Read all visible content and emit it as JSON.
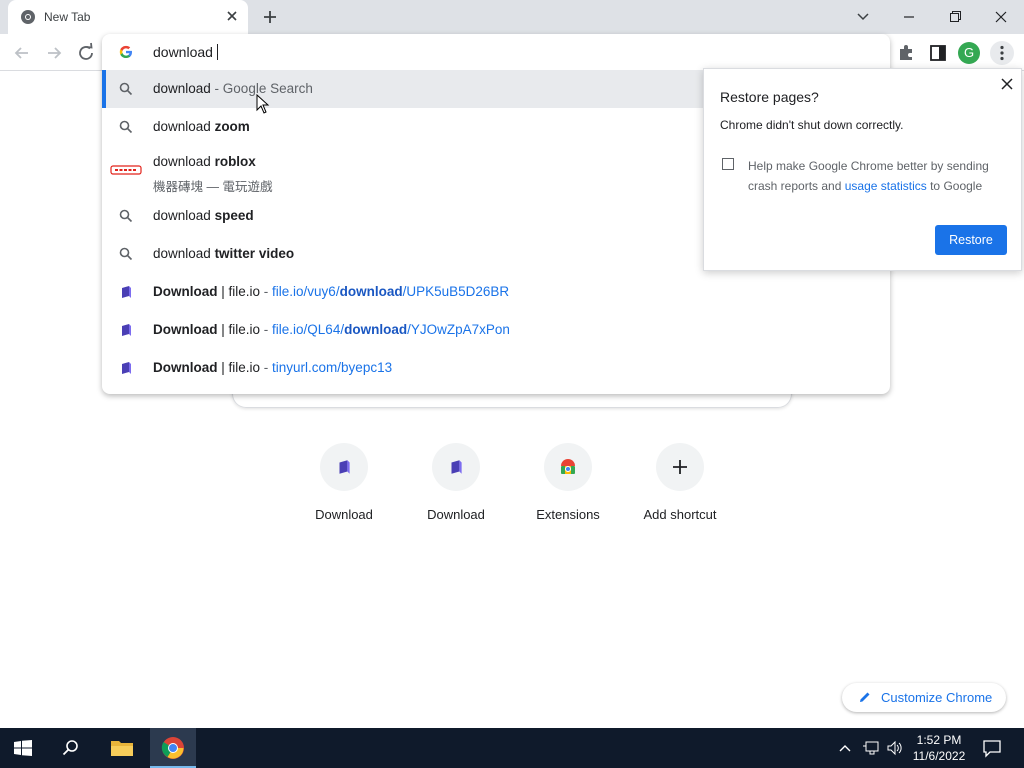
{
  "browser": {
    "tab": {
      "title": "New Tab"
    },
    "omnibox": {
      "query": "download"
    }
  },
  "suggestions": [
    {
      "icon": "search-icon",
      "prefix": "download",
      "bold": "",
      "sep": " - ",
      "rest": "Google Search"
    },
    {
      "icon": "search-icon",
      "prefix": "download ",
      "bold": "zoom"
    },
    {
      "icon": "roblox-icon",
      "prefix": "download ",
      "bold": "roblox",
      "sub": "機器磚塊 — 電玩遊戲"
    },
    {
      "icon": "search-icon",
      "prefix": "download ",
      "bold": "speed"
    },
    {
      "icon": "search-icon",
      "prefix": "download ",
      "bold": "twitter video"
    },
    {
      "icon": "fileio-icon",
      "title_bold": "Download",
      "title_rest": " | file.io",
      "sep": " - ",
      "url_a": "file.io/vuy6/",
      "url_b": "download",
      "url_c": "/UPK5uB5D26BR"
    },
    {
      "icon": "fileio-icon",
      "title_bold": "Download",
      "title_rest": " | file.io",
      "sep": " - ",
      "url_a": "file.io/QL64/",
      "url_b": "download",
      "url_c": "/YJOwZpA7xPon"
    },
    {
      "icon": "fileio-icon",
      "title_bold": "Download",
      "title_rest": " | file.io",
      "sep": " - ",
      "url_a": "tinyurl.com/byepc13",
      "url_b": "",
      "url_c": ""
    }
  ],
  "restore_popup": {
    "title": "Restore pages?",
    "message": "Chrome didn't shut down correctly.",
    "help_text_a": "Help make Google Chrome better by sending crash reports and ",
    "help_link": "usage statistics",
    "help_text_b": " to Google",
    "restore_label": "Restore"
  },
  "shortcuts": [
    {
      "label": "Download",
      "icon": "fileio-icon"
    },
    {
      "label": "Download",
      "icon": "fileio-icon"
    },
    {
      "label": "Extensions",
      "icon": "chrome-web-store-icon"
    },
    {
      "label": "Add shortcut",
      "icon": "plus-icon"
    }
  ],
  "customize": {
    "label": "Customize Chrome"
  },
  "profile": {
    "initial": "G"
  },
  "taskbar": {
    "time": "1:52 PM",
    "date": "11/6/2022"
  },
  "colors": {
    "accent": "#1a73e8",
    "profile": "#34a853",
    "taskbar": "#0f1a2b"
  }
}
